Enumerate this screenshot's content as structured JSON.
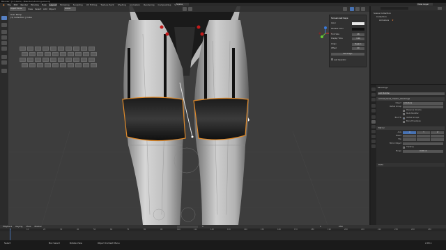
{
  "titlebar": {
    "text": "Blender* [C:\\Users\\...\\Blender\\stockings.blend]"
  },
  "menubar": {
    "menus": [
      "File",
      "Edit",
      "Render",
      "Window",
      "Help"
    ],
    "workspaces": [
      "Layout",
      "Modeling",
      "Sculpting",
      "UV Editing",
      "Texture Paint",
      "Shading",
      "Animation",
      "Rendering",
      "Compositing",
      "Scripting"
    ],
    "active_workspace": "Layout",
    "scene": "Scene",
    "view_layer": "View Layer"
  },
  "viewport": {
    "header": {
      "mode": "Object Mode",
      "view": "View",
      "select": "Select",
      "add": "Add",
      "object": "Object",
      "orientation": "Global"
    },
    "overlay_text": [
      "User Persp",
      "(1) Collection | Cube"
    ],
    "npanel": {
      "title": "Screencast Keys",
      "rows": [
        {
          "label": "Color",
          "value": ""
        },
        {
          "label": "Shadow Color",
          "value": ""
        },
        {
          "label": "Font Size",
          "value": "28"
        },
        {
          "label": "Display Time",
          "value": "3.00"
        },
        {
          "label": "Origin",
          "value": "Region"
        },
        {
          "label": "Offset",
          "value": "20"
        },
        {
          "label": "Set Origin",
          "value": ""
        },
        {
          "label": "Last Operator",
          "value": ""
        }
      ]
    },
    "keyboard_keys": 40,
    "colors": {
      "bg": "#3d3d3d",
      "stocking": "#121212",
      "selection": "#e08a2a",
      "skin": "#c9c9c9"
    }
  },
  "outliner": {
    "search_placeholder": "",
    "items": [
      "Scene Collection",
      "Collection",
      "Armature",
      "Body",
      "Stockings"
    ]
  },
  "properties": {
    "object_name": "Stockings",
    "tabs_label": "Add Modifier",
    "modifiers": [
      {
        "name": "armat_basis_meshc_stockings",
        "fields": [
          {
            "label": "Object",
            "value": "Armature"
          },
          {
            "label": "Vertex Group",
            "value": ""
          }
        ],
        "checks": [
          "Preserve Volume",
          "Multi Modifier"
        ],
        "bind_to": "Bind To",
        "bind_checks": [
          "Vertex Groups",
          "Bone Envelopes"
        ]
      },
      {
        "name": "Mirror",
        "axis_label": "Axis",
        "bisect_label": "Bisect",
        "flip_label": "Flip",
        "axes": [
          "X",
          "Y",
          "Z"
        ],
        "mirror_object_label": "Mirror Object",
        "clipping_label": "Clipping",
        "merge_label": "Merge",
        "merge_value": "0.001 m"
      }
    ],
    "data_label": "Data"
  },
  "timeline": {
    "menus": [
      "Playback",
      "Keying",
      "View",
      "Marker"
    ],
    "frame_start": "1",
    "frame_end": "250",
    "current_frame": "1",
    "ticks": [
      "0",
      "10",
      "20",
      "30",
      "40",
      "50",
      "60",
      "70",
      "80",
      "90",
      "100",
      "110",
      "120",
      "130",
      "140",
      "150",
      "160",
      "170",
      "180",
      "190",
      "200",
      "210",
      "220",
      "230",
      "240",
      "250"
    ]
  },
  "statusbar": {
    "left": "Select",
    "middle": "Box Select",
    "right": "Rotate View",
    "right2": "Object Context Menu",
    "version": "2.93.1"
  }
}
